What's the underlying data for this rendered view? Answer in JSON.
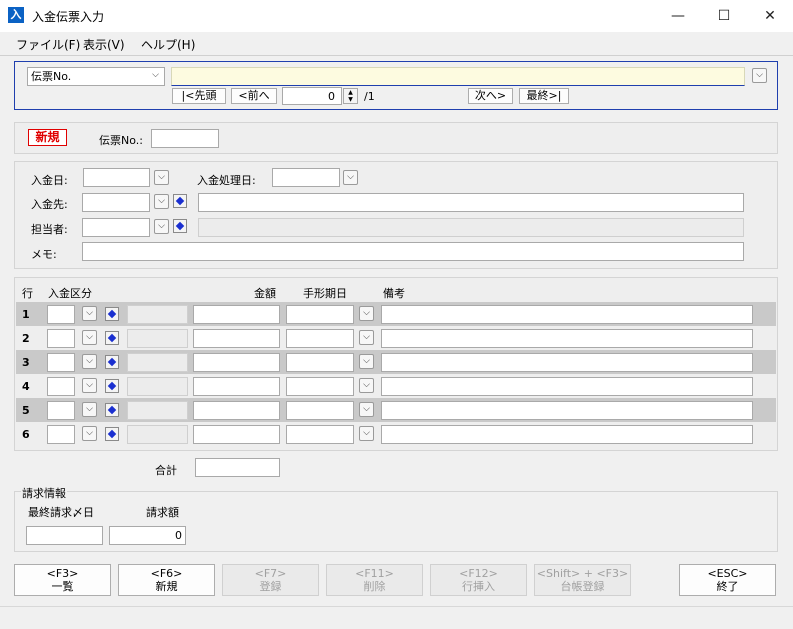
{
  "window": {
    "title": "入金伝票入力",
    "icon_text": "入"
  },
  "window_controls": {
    "minimize": "—",
    "maximize": "☐",
    "close": "✕"
  },
  "menu": {
    "file": "ファイル(F)",
    "view": "表示(V)",
    "help": "ヘルプ(H)"
  },
  "search": {
    "field_select": "伝票No.",
    "value": "",
    "first": "|<先頭",
    "prev": "<前へ",
    "page": "0",
    "total": "/1",
    "next": "次へ>",
    "last": "最終>|"
  },
  "header": {
    "mode_badge": "新規",
    "slip_no_label": "伝票No.:",
    "slip_no_value": ""
  },
  "form": {
    "date_label": "入金日:",
    "process_date_label": "入金処理日:",
    "payer_label": "入金先:",
    "staff_label": "担当者:",
    "memo_label": "メモ:"
  },
  "grid": {
    "col_row": "行",
    "col_type": "入金区分",
    "col_amount": "金額",
    "col_due": "手形期日",
    "col_note": "備考",
    "rows": [
      {
        "num": "1"
      },
      {
        "num": "2"
      },
      {
        "num": "3"
      },
      {
        "num": "4"
      },
      {
        "num": "5"
      },
      {
        "num": "6"
      }
    ],
    "total_label": "合計",
    "total_value": ""
  },
  "billing": {
    "group_label": "請求情報",
    "last_close_label": "最終請求〆日",
    "amount_label": "請求額",
    "last_close_value": "",
    "amount_value": "0"
  },
  "fkeys": {
    "list_key": "<F3>",
    "list_label": "一覧",
    "new_key": "<F6>",
    "new_label": "新規",
    "save_key": "<F7>",
    "save_label": "登録",
    "delete_key": "<F11>",
    "delete_label": "削除",
    "insert_key": "<F12>",
    "insert_label": "行挿入",
    "ledger_key": "<Shift> + <F3>",
    "ledger_label": "台帳登録",
    "exit_key": "<ESC>",
    "exit_label": "終了"
  },
  "colors": {
    "badge_red": "#e00000",
    "search_bg": "#fdfbe0",
    "accent_border": "#1f3fae",
    "diamond": "#1a2fd0"
  }
}
